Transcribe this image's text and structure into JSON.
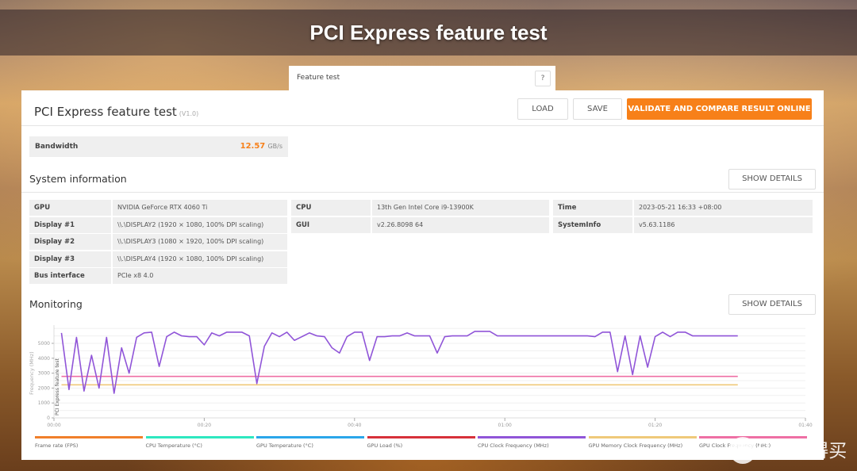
{
  "header": {
    "title": "PCI Express feature test"
  },
  "tab": {
    "label": "Feature test",
    "help_label": "?"
  },
  "panel": {
    "title": "PCI Express feature test",
    "version": "(V1.0)",
    "buttons": {
      "load": "LOAD",
      "save": "SAVE",
      "validate": "VALIDATE AND COMPARE RESULT ONLINE"
    }
  },
  "bandwidth": {
    "label": "Bandwidth",
    "value": "12.57",
    "unit": "GB/s"
  },
  "system_info": {
    "title": "System information",
    "show_details": "SHOW DETAILS",
    "col1": [
      {
        "key": "GPU",
        "value": "NVIDIA GeForce RTX 4060 Ti"
      },
      {
        "key": "Display #1",
        "value": "\\\\.\\DISPLAY2 (1920 × 1080, 100% DPI scaling)"
      },
      {
        "key": "Display #2",
        "value": "\\\\.\\DISPLAY3 (1080 × 1920, 100% DPI scaling)"
      },
      {
        "key": "Display #3",
        "value": "\\\\.\\DISPLAY4 (1920 × 1080, 100% DPI scaling)"
      },
      {
        "key": "Bus interface",
        "value": "PCIe x8 4.0"
      }
    ],
    "col2": [
      {
        "key": "CPU",
        "value": "13th Gen Intel Core i9-13900K"
      },
      {
        "key": "GUI",
        "value": "v2.26.8098 64"
      }
    ],
    "col3": [
      {
        "key": "Time",
        "value": "2023-05-21 16:33 +08:00"
      },
      {
        "key": "SystemInfo",
        "value": "v5.63.1186"
      }
    ]
  },
  "monitoring": {
    "title": "Monitoring",
    "show_details": "SHOW DETAILS"
  },
  "chart_data": {
    "type": "line",
    "title": "",
    "xlabel": "",
    "ylabel": "Frequency (MHz)",
    "annotation": "PCI Express feature test",
    "xlim_seconds": [
      0,
      100
    ],
    "ylim": [
      0,
      6000
    ],
    "x_ticks": [
      {
        "t": 0,
        "label": "00:00"
      },
      {
        "t": 20,
        "label": "00:20"
      },
      {
        "t": 40,
        "label": "00:40"
      },
      {
        "t": 60,
        "label": "01:00"
      },
      {
        "t": 80,
        "label": "01:20"
      },
      {
        "t": 100,
        "label": "01:40"
      }
    ],
    "y_ticks": [
      0,
      1000,
      2000,
      3000,
      4000,
      5000
    ],
    "grid": true,
    "legend_position": "bottom",
    "legend": [
      {
        "name": "Frame rate (FPS)",
        "color": "#f07f2a"
      },
      {
        "name": "CPU Temperature (°C)",
        "color": "#2ee8c0"
      },
      {
        "name": "GPU Temperature (°C)",
        "color": "#2aa6ea"
      },
      {
        "name": "GPU Load (%)",
        "color": "#d7313a"
      },
      {
        "name": "CPU Clock Frequency (MHz)",
        "color": "#9055d8"
      },
      {
        "name": "GPU Memory Clock Frequency (MHz)",
        "color": "#efc97a"
      },
      {
        "name": "GPU Clock Frequency (MHz)",
        "color": "#ee6fa4"
      }
    ],
    "series": [
      {
        "name": "CPU Clock Frequency (MHz)",
        "color": "#9055d8",
        "t": [
          1,
          2,
          3,
          4,
          5,
          6,
          7,
          8,
          9,
          10,
          11,
          12,
          13,
          14,
          15,
          16,
          17,
          18,
          19,
          20,
          21,
          22,
          23,
          24,
          25,
          26,
          27,
          28,
          29,
          30,
          31,
          32,
          33,
          34,
          35,
          36,
          37,
          38,
          39,
          40,
          41,
          42,
          43,
          44,
          45,
          46,
          47,
          48,
          49,
          50,
          51,
          52,
          53,
          54,
          55,
          56,
          57,
          58,
          59,
          60,
          61,
          62,
          63,
          64,
          65,
          66,
          67,
          68,
          69,
          70,
          71,
          72,
          73,
          74,
          75,
          76,
          77,
          78,
          79,
          80,
          81,
          82,
          83,
          84,
          85,
          86,
          87,
          88,
          89,
          90,
          91
        ],
        "values": [
          5700,
          1900,
          5400,
          1800,
          4200,
          2000,
          5400,
          1650,
          4700,
          3000,
          5400,
          5700,
          5750,
          3450,
          5450,
          5750,
          5500,
          5450,
          5450,
          4900,
          5700,
          5500,
          5750,
          5750,
          5750,
          5500,
          2300,
          4800,
          5700,
          5450,
          5750,
          5200,
          5450,
          5700,
          5500,
          5450,
          4700,
          4350,
          5450,
          5750,
          5750,
          3850,
          5450,
          5450,
          5500,
          5500,
          5700,
          5500,
          5500,
          5500,
          4350,
          5450,
          5500,
          5500,
          5500,
          5800,
          5800,
          5800,
          5500,
          5500,
          5500,
          5500,
          5500,
          5500,
          5500,
          5500,
          5500,
          5500,
          5500,
          5500,
          5500,
          5450,
          5750,
          5750,
          3100,
          5500,
          2900,
          5500,
          3400,
          5450,
          5750,
          5450,
          5750,
          5750,
          5500,
          5500,
          5500,
          5500,
          5500,
          5500,
          5500
        ]
      },
      {
        "name": "GPU Clock Frequency (MHz)",
        "color": "#ee6fa4",
        "t": [
          1,
          91
        ],
        "values": [
          2780,
          2780
        ]
      },
      {
        "name": "GPU Memory Clock Frequency (MHz)",
        "color": "#efc97a",
        "t": [
          1,
          91
        ],
        "values": [
          2220,
          2220
        ]
      }
    ]
  },
  "watermark": {
    "text": "值 什么值得买"
  }
}
